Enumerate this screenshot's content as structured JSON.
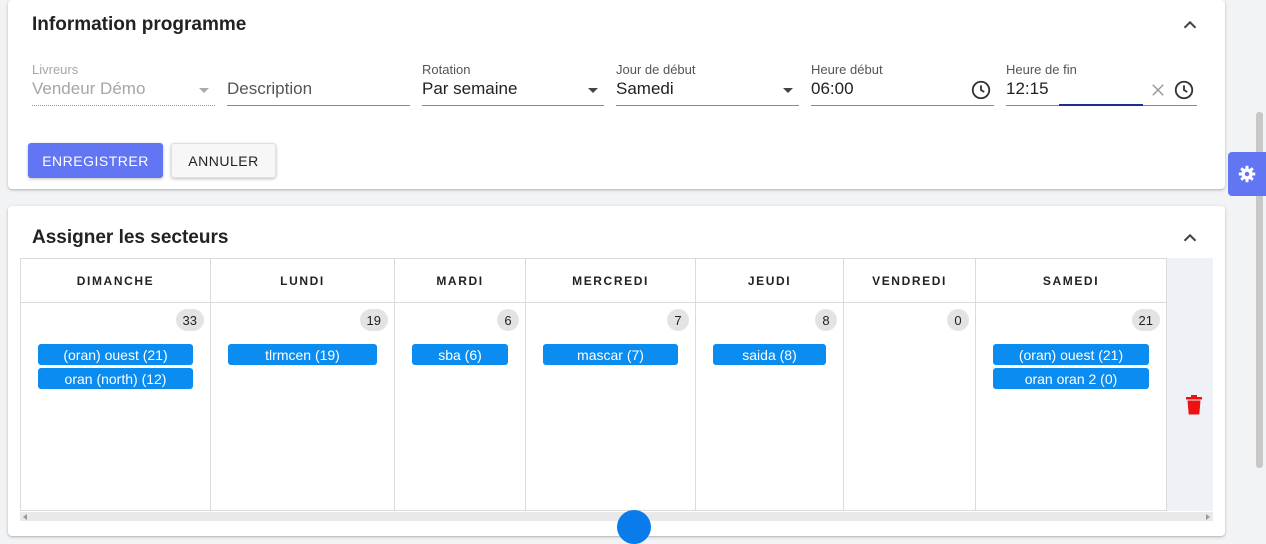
{
  "program_info": {
    "title": "Information programme",
    "fields": {
      "livreurs": {
        "label": "Livreurs",
        "value": "Vendeur Démo"
      },
      "description": {
        "placeholder": "Description"
      },
      "rotation": {
        "label": "Rotation",
        "value": "Par semaine"
      },
      "jour_debut": {
        "label": "Jour de début",
        "value": "Samedi"
      },
      "heure_debut": {
        "label": "Heure début",
        "value": "06:00"
      },
      "heure_fin": {
        "label": "Heure de fin",
        "value": "12:15"
      }
    },
    "buttons": {
      "save": "ENREGISTRER",
      "cancel": "ANNULER"
    }
  },
  "assign_sectors": {
    "title": "Assigner les secteurs",
    "days": [
      {
        "name": "DIMANCHE",
        "count": "33",
        "sectors": [
          "(oran) ouest (21)",
          "oran (north) (12)"
        ]
      },
      {
        "name": "LUNDI",
        "count": "19",
        "sectors": [
          "tlrmcen (19)"
        ]
      },
      {
        "name": "MARDI",
        "count": "6",
        "sectors": [
          "sba (6)"
        ]
      },
      {
        "name": "MERCREDI",
        "count": "7",
        "sectors": [
          "mascar (7)"
        ]
      },
      {
        "name": "JEUDI",
        "count": "8",
        "sectors": [
          "saida (8)"
        ]
      },
      {
        "name": "VENDREDI",
        "count": "0",
        "sectors": []
      },
      {
        "name": "SAMEDI",
        "count": "21",
        "sectors": [
          "(oran) ouest (21)",
          "oran oran 2 (0)"
        ]
      }
    ]
  },
  "colors": {
    "primary": "#6276f4",
    "chip": "#0a8cf0",
    "delete": "#ee1111"
  },
  "icons": [
    "chevron-up-icon",
    "clock-icon",
    "clear-icon",
    "trash-icon",
    "gear-icon"
  ]
}
